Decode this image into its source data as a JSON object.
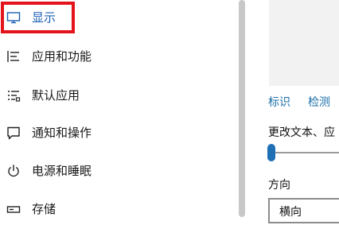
{
  "sidebar": {
    "items": [
      {
        "label": "显示",
        "icon": "display-icon"
      },
      {
        "label": "应用和功能",
        "icon": "apps-list-icon"
      },
      {
        "label": "默认应用",
        "icon": "default-apps-icon"
      },
      {
        "label": "通知和操作",
        "icon": "notification-icon"
      },
      {
        "label": "电源和睡眠",
        "icon": "power-icon"
      },
      {
        "label": "存储",
        "icon": "storage-icon"
      }
    ]
  },
  "display": {
    "identify_label": "标识",
    "detect_label": "检测",
    "scale_text": "更改文本、应",
    "orientation_label": "方向",
    "orientation_value": "横向"
  },
  "colors": {
    "accent": "#1f6fb5",
    "link": "#1a6fa8",
    "highlight_box": "#e3141b"
  }
}
